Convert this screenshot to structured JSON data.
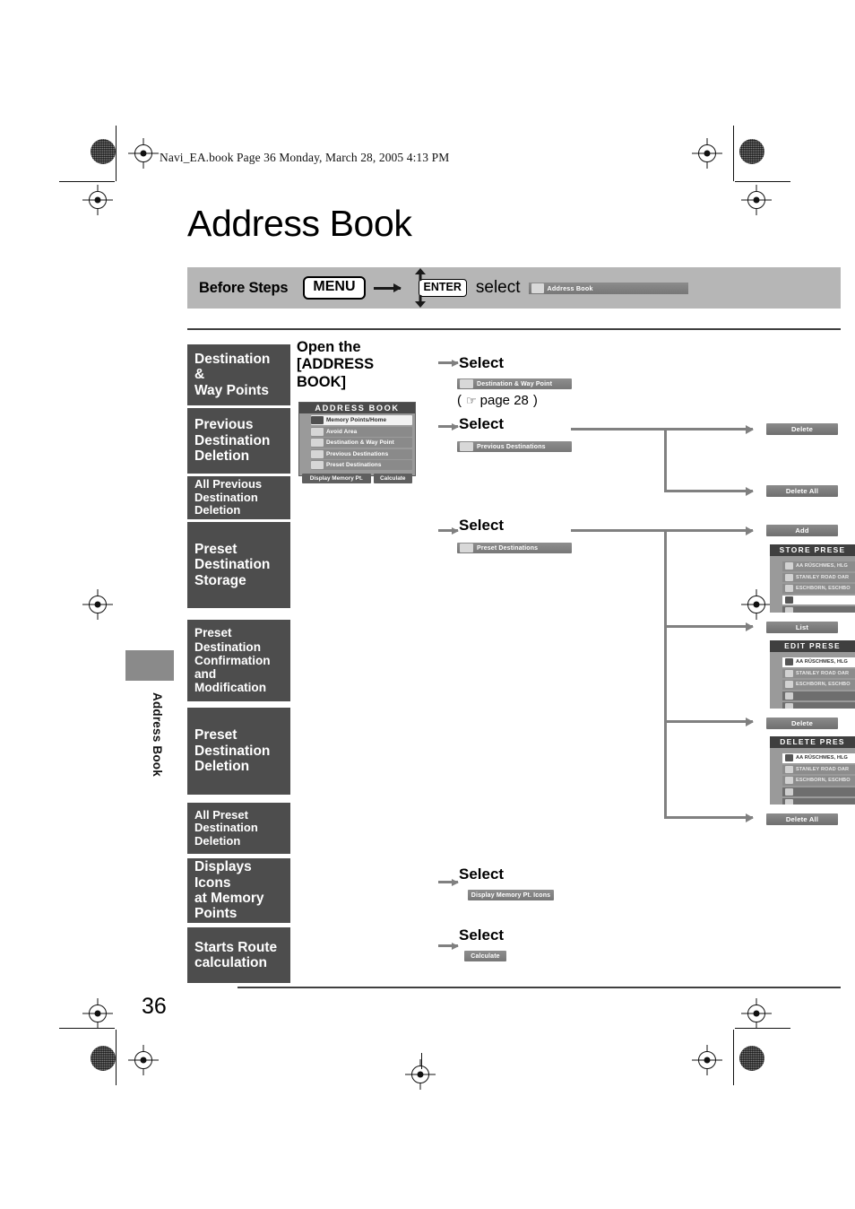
{
  "document": {
    "slug": "Navi_EA.book  Page 36  Monday, March 28, 2005  4:13 PM",
    "title": "Address Book",
    "side_tab_label": "Address Book",
    "page_number": "36"
  },
  "before_steps": {
    "label": "Before Steps",
    "menu_key": "MENU",
    "enter_key": "ENTER",
    "select_word": "select",
    "target_item": "Address Book",
    "target_icon": "address-book-icon"
  },
  "sidebar": {
    "items": [
      {
        "label": "Destination &\nWay Points",
        "size": "big"
      },
      {
        "label": "Previous\nDestination\nDeletion",
        "size": "big"
      },
      {
        "label": "All Previous\nDestination Deletion",
        "size": "sml"
      },
      {
        "label": "Preset\nDestination\nStorage",
        "size": "big"
      },
      {
        "label": "Preset Destination\nConfirmation and\nModification",
        "size": "med"
      },
      {
        "label": "Preset\nDestination\nDeletion",
        "size": "big"
      },
      {
        "label": "All Preset\nDestination Deletion",
        "size": "sml"
      },
      {
        "label": "Displays Icons\nat Memory\nPoints",
        "size": "big"
      },
      {
        "label": "Starts Route\ncalculation",
        "size": "big"
      }
    ]
  },
  "section": {
    "open_heading": "Open the\n[ADDRESS\nBOOK]"
  },
  "address_book_screen": {
    "title": "ADDRESS BOOK",
    "rows": [
      {
        "label": "Memory Points/Home",
        "style": "light",
        "icon": "memory-point-icon"
      },
      {
        "label": "Avoid Area",
        "style": "dark",
        "icon": "avoid-area-icon"
      },
      {
        "label": "Destination & Way Point",
        "style": "dark",
        "icon": "destination-waypoint-icon"
      },
      {
        "label": "Previous Destinations",
        "style": "dark",
        "icon": "previous-destinations-icon"
      },
      {
        "label": "Preset Destinations",
        "style": "dark",
        "icon": "preset-destinations-icon"
      }
    ],
    "footer_buttons": [
      "Display Memory Pt. Icons",
      "Calculate"
    ]
  },
  "steps": [
    {
      "heading": "Select",
      "chip": "Destination & Way Point",
      "chip_icon": "destination-waypoint-icon",
      "reference": "page 28",
      "reference_prefix": "(",
      "reference_suffix": ")",
      "reference_icon": "pointing-hand-icon"
    },
    {
      "heading": "Select",
      "chip": "Previous Destinations",
      "chip_icon": "previous-destinations-icon"
    },
    {
      "heading": "Select",
      "chip": "Preset Destinations",
      "chip_icon": "preset-destinations-icon"
    },
    {
      "heading": "Select",
      "chip": "Display Memory Pt. Icons",
      "chip_icon": "display-icons-icon"
    },
    {
      "heading": "Select",
      "chip": "Calculate",
      "chip_icon": "calculate-icon"
    }
  ],
  "results": {
    "delete_button": "Delete",
    "delete_all_button": "Delete All",
    "add_button": "Add",
    "list_button": "List",
    "preset_delete_button": "Delete",
    "preset_delete_all_button": "Delete All",
    "store_panel": {
      "title": "STORE PRESE",
      "rows": [
        {
          "label": "AA RÜSCHMES, HLG",
          "style": "g"
        },
        {
          "label": "STANLEY ROAD OAR",
          "style": "g"
        },
        {
          "label": "ESCHBORN, ESCHBO",
          "style": "g"
        },
        {
          "label": "",
          "style": "w"
        },
        {
          "label": "",
          "style": "d"
        }
      ]
    },
    "edit_panel": {
      "title": "EDIT PRESE",
      "rows": [
        {
          "label": "AA RÜSCHMES, HLG",
          "style": "w"
        },
        {
          "label": "STANLEY ROAD OAR",
          "style": "g"
        },
        {
          "label": "ESCHBORN, ESCHBO",
          "style": "g"
        },
        {
          "label": "",
          "style": "d"
        },
        {
          "label": "",
          "style": "d"
        }
      ]
    },
    "delete_panel": {
      "title": "DELETE PRES",
      "rows": [
        {
          "label": "AA RÜSCHMES, HLG",
          "style": "w"
        },
        {
          "label": "STANLEY ROAD OAR",
          "style": "g"
        },
        {
          "label": "ESCHBORN, ESCHBO",
          "style": "g"
        },
        {
          "label": "",
          "style": "d"
        },
        {
          "label": "",
          "style": "d"
        }
      ]
    }
  }
}
